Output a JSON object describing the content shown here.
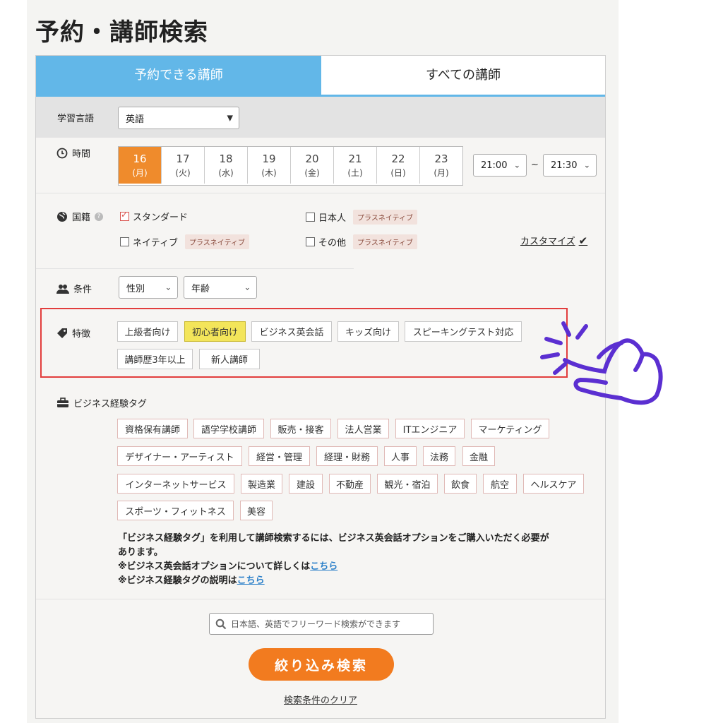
{
  "page": {
    "title": "予約・講師検索"
  },
  "tabs": {
    "reservable": "予約できる講師",
    "all": "すべての講師"
  },
  "language": {
    "label": "学習言語",
    "value": "英語"
  },
  "time": {
    "label": "時間",
    "dates": [
      {
        "day": "16",
        "dow": "(月)"
      },
      {
        "day": "17",
        "dow": "(火)"
      },
      {
        "day": "18",
        "dow": "(水)"
      },
      {
        "day": "19",
        "dow": "(木)"
      },
      {
        "day": "20",
        "dow": "(金)"
      },
      {
        "day": "21",
        "dow": "(土)"
      },
      {
        "day": "22",
        "dow": "(日)"
      },
      {
        "day": "23",
        "dow": "(月)"
      }
    ],
    "from": "21:00",
    "separator": "~",
    "to": "21:30"
  },
  "nationality": {
    "label": "国籍",
    "standard": "スタンダード",
    "japanese": "日本人",
    "native": "ネイティブ",
    "other": "その他",
    "plus_badge": "プラスネイティブ",
    "customize": "カスタマイズ"
  },
  "conditions": {
    "label": "条件",
    "gender": "性別",
    "age": "年齢"
  },
  "features": {
    "label": "特徴",
    "tags": [
      "上級者向け",
      "初心者向け",
      "ビジネス英会話",
      "キッズ向け",
      "スピーキングテスト対応",
      "講師歴3年以上",
      "新人講師"
    ]
  },
  "business": {
    "label": "ビジネス経験タグ",
    "tags": [
      "資格保有講師",
      "語学学校講師",
      "販売・接客",
      "法人営業",
      "ITエンジニア",
      "マーケティング",
      "デザイナー・アーティスト",
      "経営・管理",
      "経理・財務",
      "人事",
      "法務",
      "金融",
      "インターネットサービス",
      "製造業",
      "建設",
      "不動産",
      "観光・宿泊",
      "飲食",
      "航空",
      "ヘルスケア",
      "スポーツ・フィットネス",
      "美容"
    ],
    "note_line1": "「ビジネス経験タグ」を利用して講師検索するには、ビジネス英会話オプションをご購入いただく必要が",
    "note_line2": "あります。",
    "note3_prefix": "※ビジネス英会話オプションについて詳しくは",
    "note4_prefix": "※ビジネス経験タグの説明は",
    "link_text": "こちら"
  },
  "search": {
    "placeholder": "日本語、英語でフリーワード検索ができます",
    "button": "絞り込み検索",
    "clear": "検索条件のクリア"
  },
  "colors": {
    "tab_active": "#62b7e8",
    "date_selected": "#ef8b2c",
    "search_button": "#f27b1f",
    "highlight_tag": "#f3e55a",
    "annotation_box": "#e23d3d",
    "hand": "#5b2fd1"
  }
}
